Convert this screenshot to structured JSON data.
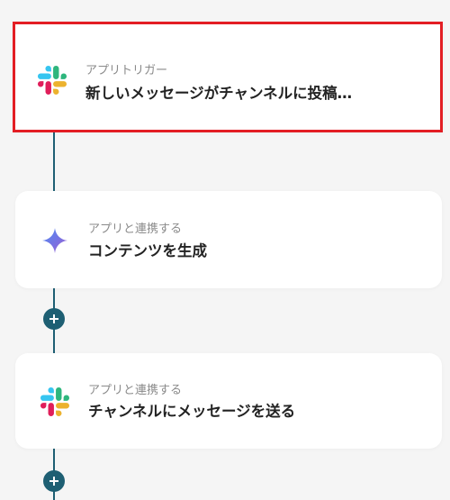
{
  "steps": [
    {
      "caption": "アプリトリガー",
      "title": "新しいメッセージがチャンネルに投稿…",
      "icon": "slack-icon",
      "selected": true
    },
    {
      "caption": "アプリと連携する",
      "title": "コンテンツを生成",
      "icon": "gemini-sparkle-icon",
      "selected": false
    },
    {
      "caption": "アプリと連携する",
      "title": "チャンネルにメッセージを送る",
      "icon": "slack-icon",
      "selected": false
    }
  ],
  "colors": {
    "connector": "#1e5f73",
    "highlight": "#e31e24",
    "background": "#f5f5f5",
    "card": "#ffffff"
  },
  "icons": {
    "add": "plus-icon"
  }
}
